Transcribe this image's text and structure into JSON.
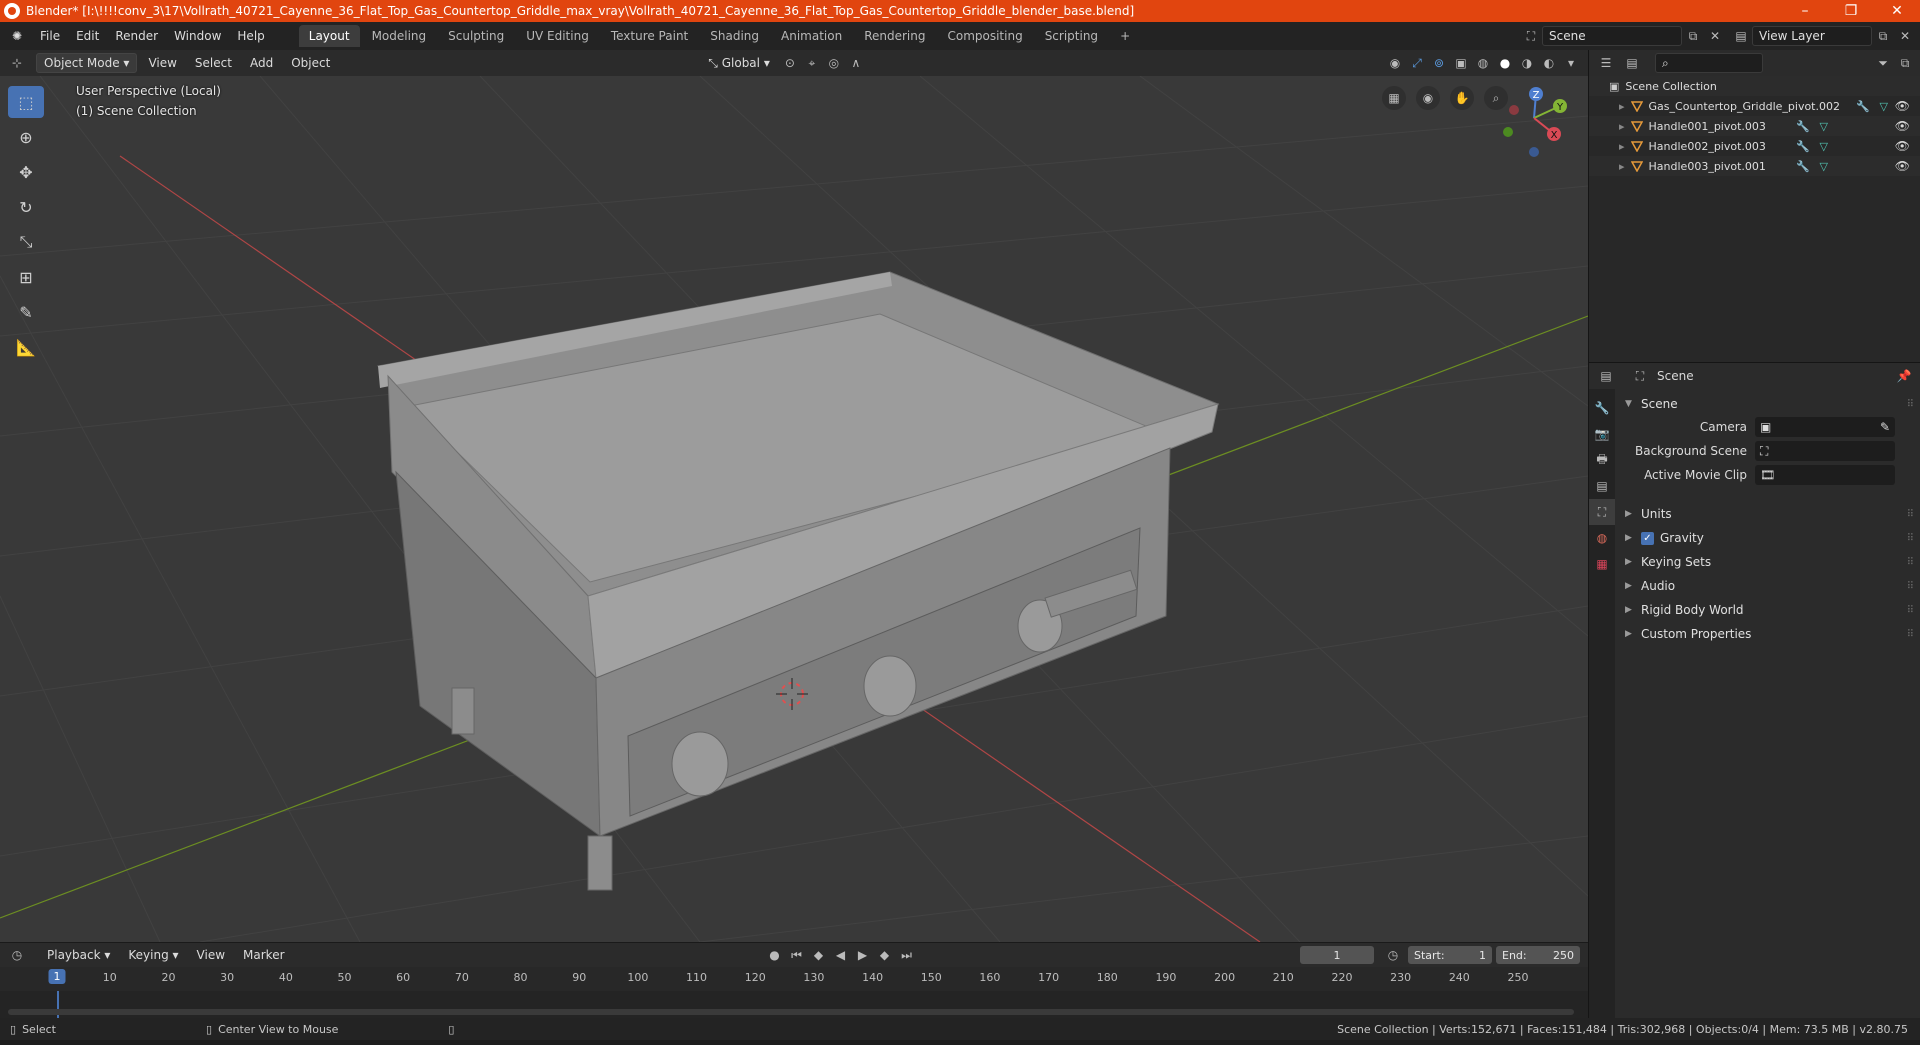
{
  "window": {
    "title": "Blender* [I:\\!!!!conv_3\\17\\Vollrath_40721_Cayenne_36_Flat_Top_Gas_Countertop_Griddle_max_vray\\Vollrath_40721_Cayenne_36_Flat_Top_Gas_Countertop_Griddle_blender_base.blend]",
    "accent": "#e1450f"
  },
  "menu": [
    "File",
    "Edit",
    "Render",
    "Window",
    "Help"
  ],
  "workspaces": [
    "Layout",
    "Modeling",
    "Sculpting",
    "UV Editing",
    "Texture Paint",
    "Shading",
    "Animation",
    "Rendering",
    "Compositing",
    "Scripting"
  ],
  "active_workspace": "Layout",
  "scene_name": "Scene",
  "view_layer": "View Layer",
  "viewport_header": {
    "mode": "Object Mode",
    "menus": [
      "View",
      "Select",
      "Add",
      "Object"
    ],
    "orientation": "Global"
  },
  "viewport": {
    "perspective": "User Perspective (Local)",
    "collection": "(1) Scene Collection",
    "gizmo": {
      "x": "X",
      "y": "Y",
      "z": "Z"
    }
  },
  "outliner": {
    "root": "Scene Collection",
    "items": [
      {
        "name": "Gas_Countertop_Griddle_pivot.002"
      },
      {
        "name": "Handle001_pivot.003"
      },
      {
        "name": "Handle002_pivot.003"
      },
      {
        "name": "Handle003_pivot.001"
      }
    ]
  },
  "properties": {
    "context": "Scene",
    "panel": "Scene",
    "fields": {
      "camera_label": "Camera",
      "background_label": "Background Scene",
      "movie_clip_label": "Active Movie Clip"
    },
    "subpanels": [
      "Units",
      "Gravity",
      "Keying Sets",
      "Audio",
      "Rigid Body World",
      "Custom Properties"
    ],
    "gravity_checked": true
  },
  "timeline": {
    "menus": [
      "Playback",
      "Keying",
      "View",
      "Marker"
    ],
    "current_frame": "1",
    "start_label": "Start:",
    "start": "1",
    "end_label": "End:",
    "end": "250",
    "ruler": [
      "1",
      "10",
      "20",
      "30",
      "40",
      "50",
      "60",
      "70",
      "80",
      "90",
      "100",
      "110",
      "120",
      "130",
      "140",
      "150",
      "160",
      "170",
      "180",
      "190",
      "200",
      "210",
      "220",
      "230",
      "240",
      "250"
    ]
  },
  "statusbar": {
    "left_action": "Select",
    "middle_action": "Center View to Mouse",
    "stats": "Scene Collection | Verts:152,671 | Faces:151,484 | Tris:302,968 | Objects:0/4 | Mem: 73.5 MB | v2.80.75"
  }
}
